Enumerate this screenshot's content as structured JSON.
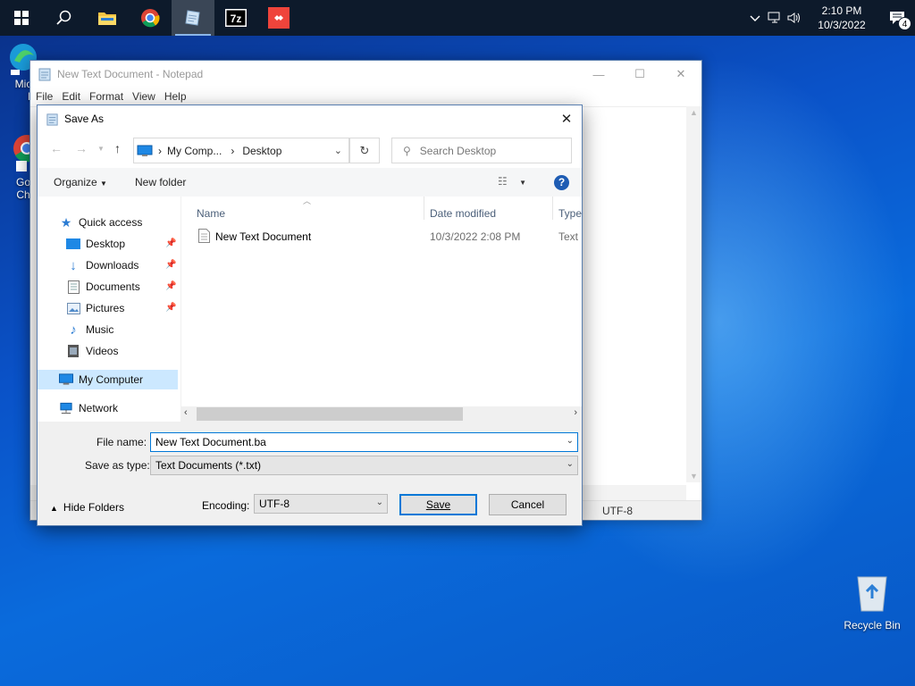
{
  "taskbar": {
    "clock_time": "2:10 PM",
    "clock_date": "10/3/2022",
    "notification_count": "4",
    "apps": [
      "start",
      "search",
      "file-explorer",
      "chrome",
      "notepad",
      "7-zip",
      "anydesk"
    ]
  },
  "desktop": {
    "icon1_label_a": "Mic",
    "icon1_label_b": "E",
    "icon2_label_a": "Go",
    "icon2_label_b": "Ch",
    "recycle_bin": "Recycle Bin"
  },
  "notepad": {
    "title": "New Text Document - Notepad",
    "menu": [
      "File",
      "Edit",
      "Format",
      "View",
      "Help"
    ],
    "status_encoding": "UTF-8"
  },
  "dialog": {
    "title": "Save As",
    "breadcrumb": [
      "My Comp...",
      "Desktop"
    ],
    "search_placeholder": "Search Desktop",
    "organize_label": "Organize",
    "new_folder_label": "New folder",
    "nav": {
      "quick_access": "Quick access",
      "items": [
        "Desktop",
        "Downloads",
        "Documents",
        "Pictures",
        "Music",
        "Videos"
      ],
      "my_computer": "My Computer",
      "network": "Network"
    },
    "columns": [
      "Name",
      "Date modified",
      "Type"
    ],
    "files": [
      {
        "name": "New Text Document",
        "date": "10/3/2022 2:08 PM",
        "type": "Text D"
      }
    ],
    "file_name_label": "File name:",
    "file_name_value": "New Text Document.ba",
    "save_type_label": "Save as type:",
    "save_type_value": "Text Documents (*.txt)",
    "hide_folders_label": "Hide Folders",
    "encoding_label": "Encoding:",
    "encoding_value": "UTF-8",
    "save_label": "Save",
    "cancel_label": "Cancel"
  },
  "colors": {
    "accent": "#0078d7",
    "selection": "#cce8ff",
    "taskbar": "#0d1a2b"
  }
}
